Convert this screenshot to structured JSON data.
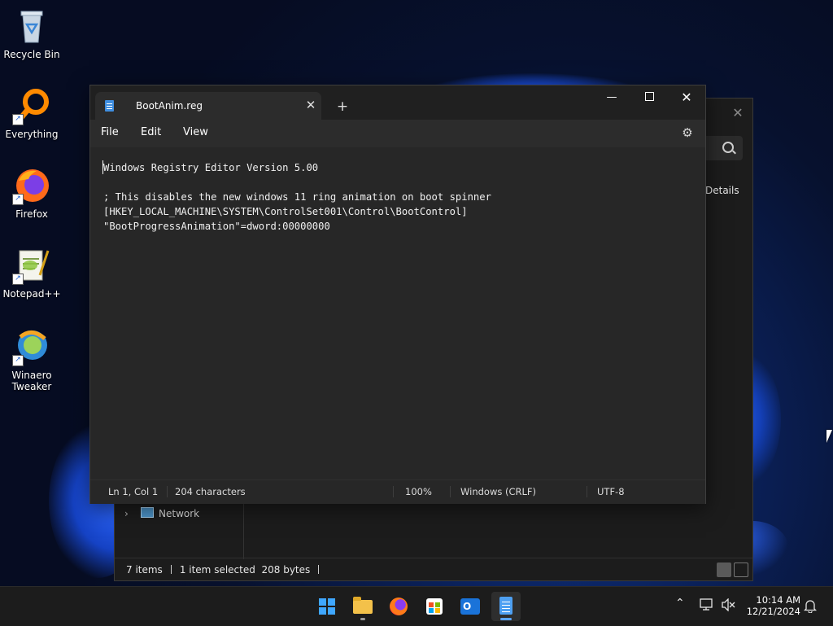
{
  "desktop": {
    "icons": [
      {
        "label": "Recycle Bin",
        "icon": "recycle-bin-icon"
      },
      {
        "label": "Everything",
        "icon": "everything-search-icon"
      },
      {
        "label": "Firefox",
        "icon": "firefox-icon"
      },
      {
        "label": "Notepad++",
        "icon": "notepadpp-icon"
      },
      {
        "label": "Winaero\nTweaker",
        "icon": "winaero-tweaker-icon"
      }
    ]
  },
  "explorer": {
    "close_glyph": "✕",
    "details_label": "Details",
    "nav_item_network": "Network",
    "status": {
      "items": "7 items",
      "selected": "1 item selected",
      "size": "208 bytes"
    }
  },
  "notepad": {
    "tab_title": "BootAnim.reg",
    "tab_close_glyph": "✕",
    "new_tab_glyph": "+",
    "window_controls": {
      "minimize": "—",
      "close": "✕"
    },
    "menu": {
      "file": "File",
      "edit": "Edit",
      "view": "View"
    },
    "settings_glyph": "⚙",
    "content": "Windows Registry Editor Version 5.00\n\n; This disables the new windows 11 ring animation on boot spinner\n[HKEY_LOCAL_MACHINE\\SYSTEM\\ControlSet001\\Control\\BootControl]\n\"BootProgressAnimation\"=dword:00000000",
    "status": {
      "position": "Ln 1, Col 1",
      "characters": "204 characters",
      "zoom": "100%",
      "line_endings": "Windows (CRLF)",
      "encoding": "UTF-8"
    }
  },
  "taskbar": {
    "apps": [
      "start-button",
      "file-explorer",
      "firefox",
      "microsoft-store",
      "outlook",
      "notepad"
    ],
    "tray": {
      "chevron_glyph": "⌃",
      "notification_glyph": "🔔"
    },
    "clock": {
      "time": "10:14 AM",
      "date": "12/21/2024"
    }
  },
  "colors": {
    "accent": "#5aa4ff",
    "notepad_bg": "#272727",
    "taskbar_bg": "#1c1c1c"
  }
}
